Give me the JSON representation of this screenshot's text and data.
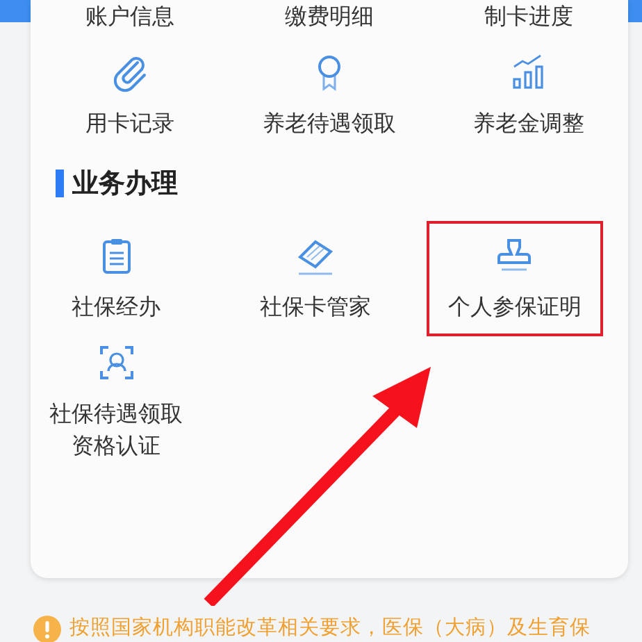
{
  "top_items": [
    {
      "lines": [
        "账户信息"
      ],
      "kind": "plain"
    },
    {
      "lines": [
        "缴费明细"
      ],
      "kind": "plain"
    },
    {
      "lines": [
        "制卡进度"
      ],
      "kind": "plain"
    },
    {
      "lines": [
        "用卡记录"
      ],
      "kind": "clip"
    },
    {
      "lines": [
        "养老待遇领取"
      ],
      "kind": "medal"
    },
    {
      "lines": [
        "养老金调整"
      ],
      "kind": "chart"
    }
  ],
  "section": {
    "title": "业务办理",
    "items": [
      {
        "lines": [
          "社保经办"
        ],
        "kind": "clipboard",
        "highlighted": false
      },
      {
        "lines": [
          "社保卡管家"
        ],
        "kind": "card",
        "highlighted": false
      },
      {
        "lines": [
          "个人参保证明"
        ],
        "kind": "stamp",
        "highlighted": true
      },
      {
        "lines": [
          "社保待遇领取",
          "资格认证"
        ],
        "kind": "face",
        "highlighted": false
      }
    ]
  },
  "notice": "按照国家机构职能改革相关要求，医保（大病）及生育保"
}
